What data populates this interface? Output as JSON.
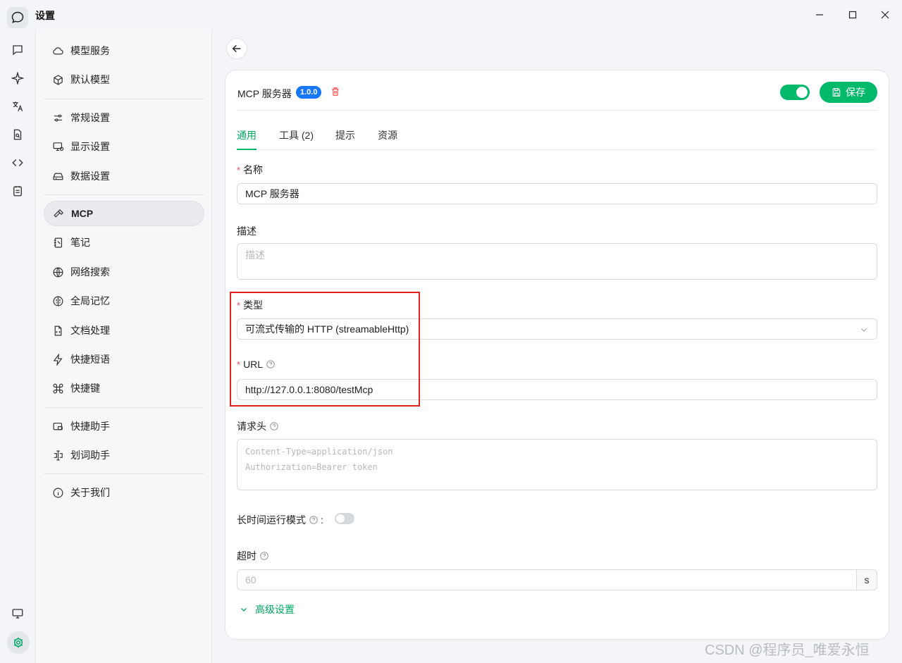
{
  "window": {
    "title": "设置",
    "controls": [
      "minimize",
      "maximize",
      "close"
    ]
  },
  "rail": {
    "icons": [
      "chat-icon",
      "sparkle-icon",
      "translate-icon",
      "file-search-icon",
      "code-icon",
      "notes-icon"
    ],
    "bottom_icons": [
      "monitor-icon",
      "gear-icon"
    ]
  },
  "sidebar": {
    "groups": [
      [
        {
          "label": "模型服务",
          "icon": "cloud-icon"
        },
        {
          "label": "默认模型",
          "icon": "cube-icon"
        }
      ],
      [
        {
          "label": "常规设置",
          "icon": "sliders-icon"
        },
        {
          "label": "显示设置",
          "icon": "display-icon"
        },
        {
          "label": "数据设置",
          "icon": "storage-icon"
        }
      ],
      [
        {
          "label": "MCP",
          "icon": "hammer-icon",
          "active": true
        },
        {
          "label": "笔记",
          "icon": "notebook-icon"
        },
        {
          "label": "网络搜索",
          "icon": "globe-icon"
        },
        {
          "label": "全局记忆",
          "icon": "brain-icon"
        },
        {
          "label": "文档处理",
          "icon": "document-icon"
        },
        {
          "label": "快捷短语",
          "icon": "bolt-icon"
        },
        {
          "label": "快捷键",
          "icon": "command-icon"
        }
      ],
      [
        {
          "label": "快捷助手",
          "icon": "assistant-icon"
        },
        {
          "label": "划词助手",
          "icon": "text-select-icon"
        }
      ],
      [
        {
          "label": "关于我们",
          "icon": "info-icon"
        }
      ]
    ]
  },
  "server": {
    "title": "MCP 服务器",
    "version": "1.0.0",
    "enabled": true,
    "save_label": "保存"
  },
  "tabs": [
    {
      "label": "通用",
      "active": true
    },
    {
      "label": "工具 (2)"
    },
    {
      "label": "提示"
    },
    {
      "label": "资源"
    }
  ],
  "form": {
    "name_label": "名称",
    "name_value": "MCP 服务器",
    "desc_label": "描述",
    "desc_placeholder": "描述",
    "type_label": "类型",
    "type_value": "可流式传输的 HTTP (streamableHttp)",
    "url_label": "URL",
    "url_value": "http://127.0.0.1:8080/testMcp",
    "headers_label": "请求头",
    "headers_placeholder_1": "Content-Type=application/json",
    "headers_placeholder_2": "Authorization=Bearer token",
    "long_running_label": "长时间运行模式",
    "long_running_colon": ":",
    "long_running_enabled": false,
    "timeout_label": "超时",
    "timeout_placeholder": "60",
    "timeout_unit": "s",
    "advanced_label": "高级设置"
  },
  "colors": {
    "accent": "#00b96b",
    "badge": "#1677ff",
    "danger": "#ff4d4f",
    "highlight": "#e5211d"
  },
  "watermark": "CSDN @程序员_唯爱永恒"
}
